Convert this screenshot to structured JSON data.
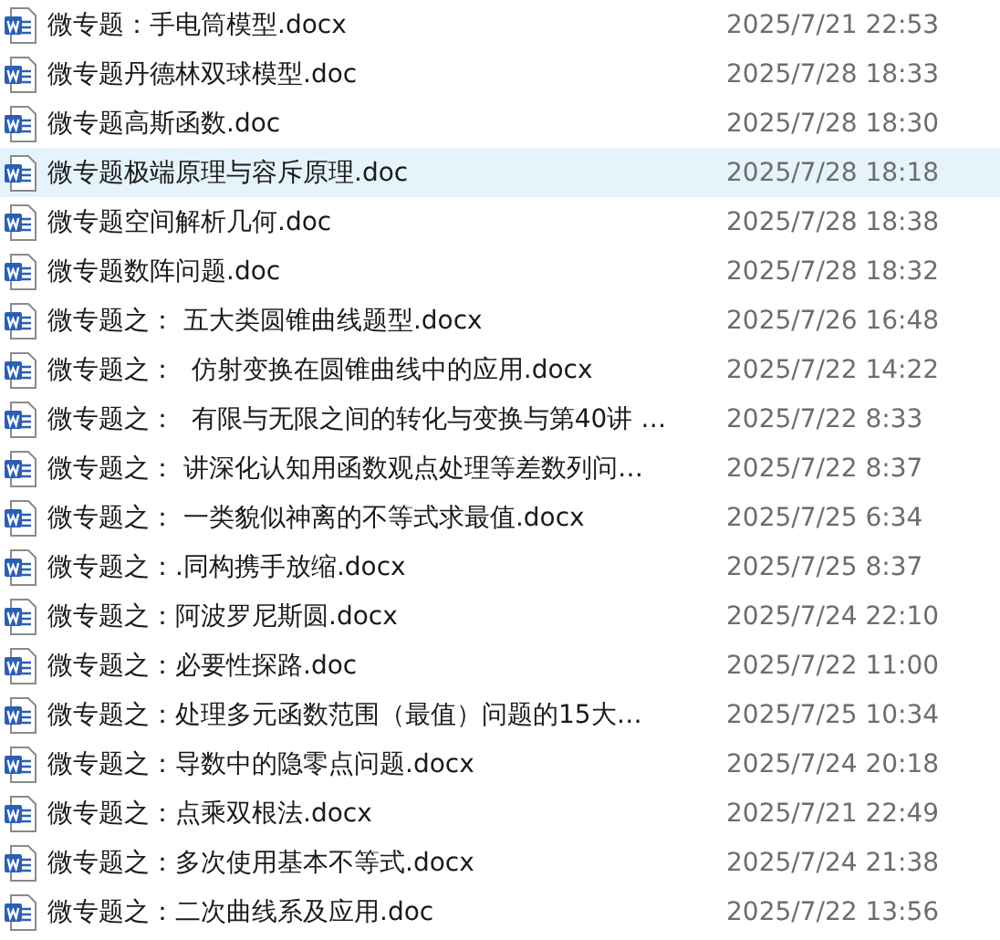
{
  "files": [
    {
      "name": "微专题：手电筒模型.docx",
      "modified": "2025/7/21 22:53",
      "selected": false
    },
    {
      "name": "微专题丹德林双球模型.doc",
      "modified": "2025/7/28 18:33",
      "selected": false
    },
    {
      "name": "微专题高斯函数.doc",
      "modified": "2025/7/28 18:30",
      "selected": false
    },
    {
      "name": "微专题极端原理与容斥原理.doc",
      "modified": "2025/7/28 18:18",
      "selected": true
    },
    {
      "name": "微专题空间解析几何.doc",
      "modified": "2025/7/28 18:38",
      "selected": false
    },
    {
      "name": "微专题数阵问题.doc",
      "modified": "2025/7/28 18:32",
      "selected": false
    },
    {
      "name": "微专题之： 五大类圆锥曲线题型.docx",
      "modified": "2025/7/26 16:48",
      "selected": false
    },
    {
      "name": "微专题之：  仿射变换在圆锥曲线中的应用.docx",
      "modified": "2025/7/22 14:22",
      "selected": false
    },
    {
      "name": "微专题之：  有限与无限之间的转化与变换与第40讲 …",
      "modified": "2025/7/22 8:33",
      "selected": false
    },
    {
      "name": "微专题之： 讲深化认知用函数观点处理等差数列问…",
      "modified": "2025/7/22 8:37",
      "selected": false
    },
    {
      "name": "微专题之： 一类貌似神离的不等式求最值.docx",
      "modified": "2025/7/25 6:34",
      "selected": false
    },
    {
      "name": "微专题之：.同构携手放缩.docx",
      "modified": "2025/7/25 8:37",
      "selected": false
    },
    {
      "name": "微专题之：阿波罗尼斯圆.docx",
      "modified": "2025/7/24 22:10",
      "selected": false
    },
    {
      "name": "微专题之：必要性探路.doc",
      "modified": "2025/7/22 11:00",
      "selected": false
    },
    {
      "name": "微专题之：处理多元函数范围（最值）问题的15大…",
      "modified": "2025/7/25 10:34",
      "selected": false
    },
    {
      "name": "微专题之：导数中的隐零点问题.docx",
      "modified": "2025/7/24 20:18",
      "selected": false
    },
    {
      "name": "微专题之：点乘双根法.docx",
      "modified": "2025/7/21 22:49",
      "selected": false
    },
    {
      "name": "微专题之：多次使用基本不等式.docx",
      "modified": "2025/7/24 21:38",
      "selected": false
    },
    {
      "name": "微专题之：二次曲线系及应用.doc",
      "modified": "2025/7/22 13:56",
      "selected": false
    }
  ]
}
